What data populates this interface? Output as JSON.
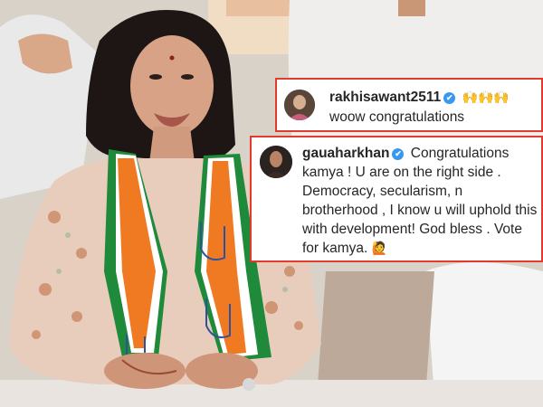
{
  "comments": [
    {
      "username": "rakhisawant2511",
      "verified": true,
      "verified_icon": "✔",
      "emojis": "🙌🙌🙌",
      "text": "woow congratulations"
    },
    {
      "username": "gauaharkhan",
      "verified": true,
      "verified_icon": "✔",
      "text": "Congratulations kamya ! U are on the right side . Democracy, secularism, n brotherhood , I know u will uphold this with development! God bless . Vote for kamya.",
      "emoji_end": "🙋"
    }
  ],
  "colors": {
    "card_border": "#e23b2e",
    "verified_badge": "#3897f0",
    "saffron": "#f07a22",
    "green": "#1f8a3a"
  },
  "icons": [
    "verified-badge-icon",
    "raising-hands-emoji",
    "woman-raising-hand-emoji"
  ]
}
